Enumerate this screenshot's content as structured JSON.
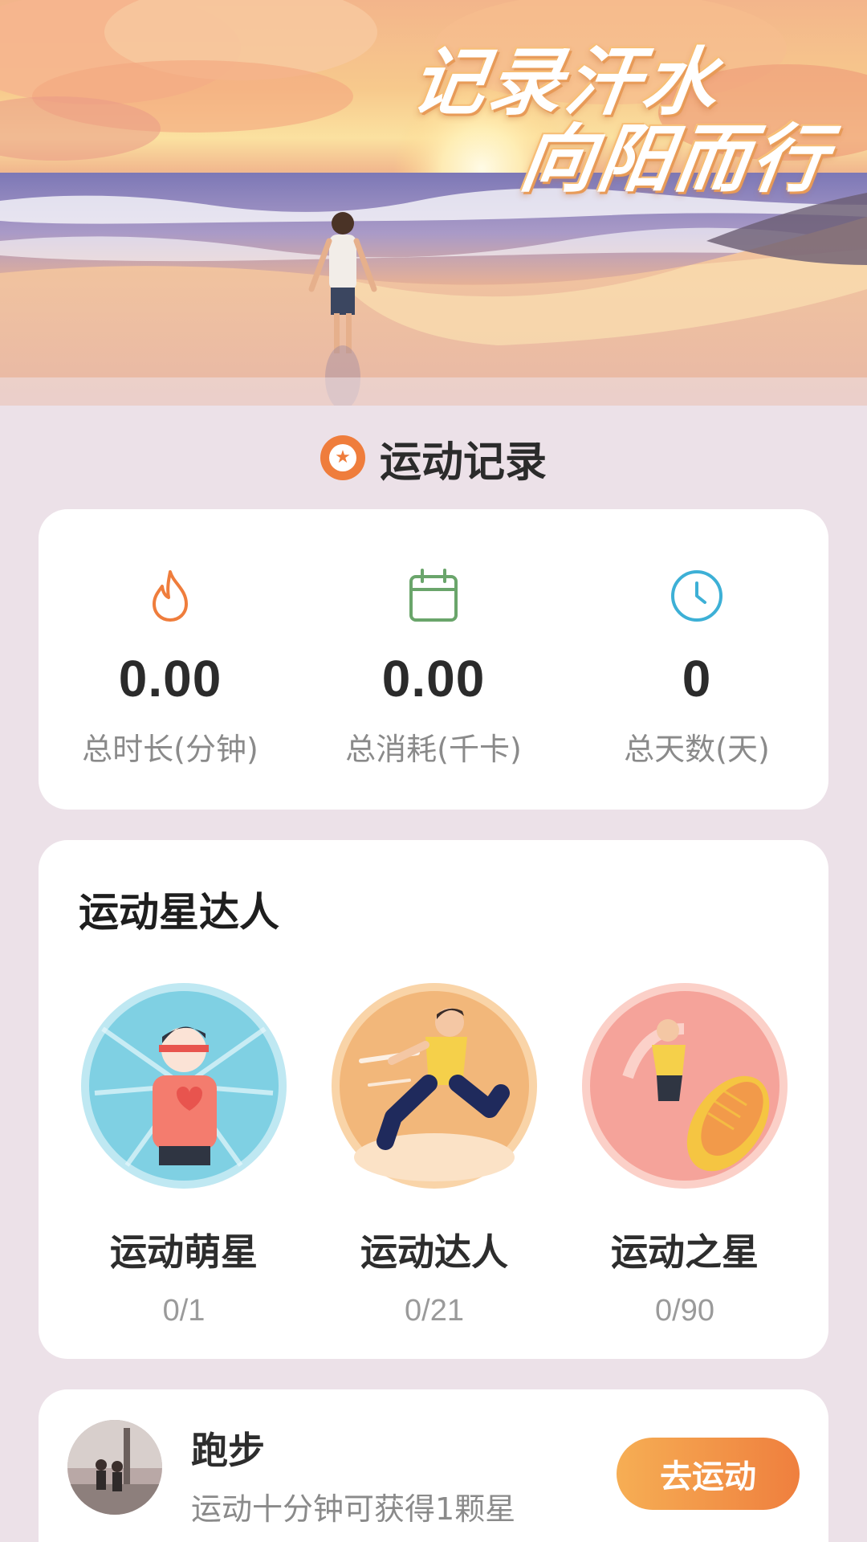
{
  "hero": {
    "title_line1": "记录汗水",
    "title_line2": "向阳而行"
  },
  "section": {
    "title": "运动记录",
    "icon": "star-badge-icon"
  },
  "stats": [
    {
      "icon": "flame-icon",
      "value": "0.00",
      "label": "总时长(分钟)",
      "color": "#ef7d3c"
    },
    {
      "icon": "calendar-icon",
      "value": "0.00",
      "label": "总消耗(千卡)",
      "color": "#6aa56b"
    },
    {
      "icon": "clock-icon",
      "value": "0",
      "label": "总天数(天)",
      "color": "#3db0d6"
    }
  ],
  "achievements": {
    "title": "运动星达人",
    "medals": [
      {
        "name": "运动萌星",
        "progress": "0/1",
        "color": "#7fd0e3"
      },
      {
        "name": "运动达人",
        "progress": "0/21",
        "color": "#f2b77a"
      },
      {
        "name": "运动之星",
        "progress": "0/90",
        "color": "#f5a39a"
      }
    ]
  },
  "task": {
    "title": "跑步",
    "description": "运动十分钟可获得1颗星",
    "button_label": "去运动"
  },
  "colors": {
    "page_bg": "#ece1e8",
    "accent": "#ef7d3c",
    "button_gradient_start": "#f6ae54",
    "button_gradient_end": "#ef7f3e"
  }
}
